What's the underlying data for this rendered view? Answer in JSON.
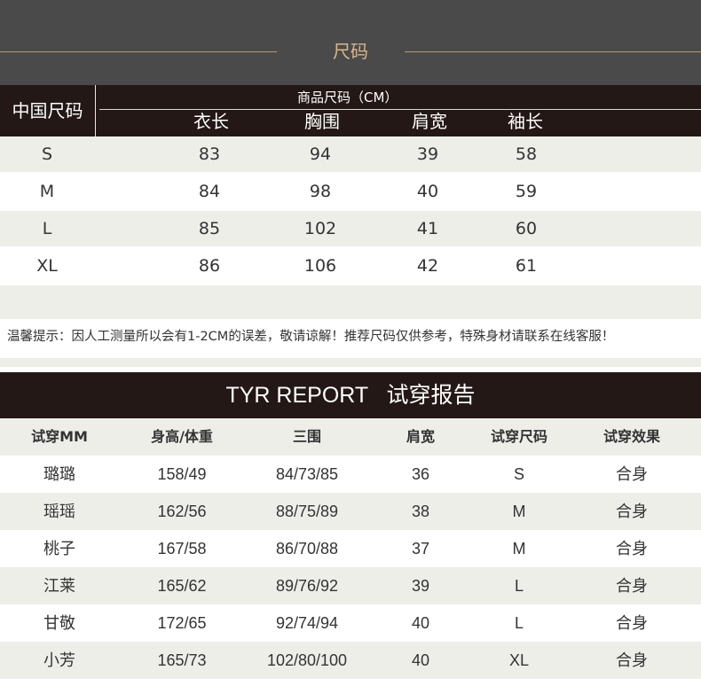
{
  "header": {
    "title": "尺码"
  },
  "size_table": {
    "cn_size_label": "中国尺码",
    "group_label": "商品尺码（CM）",
    "columns": [
      "衣长",
      "胸围",
      "肩宽",
      "袖长"
    ],
    "rows": [
      {
        "size": "S",
        "values": [
          "83",
          "94",
          "39",
          "58"
        ]
      },
      {
        "size": "M",
        "values": [
          "84",
          "98",
          "40",
          "59"
        ]
      },
      {
        "size": "L",
        "values": [
          "85",
          "102",
          "41",
          "60"
        ]
      },
      {
        "size": "XL",
        "values": [
          "86",
          "106",
          "42",
          "61"
        ]
      }
    ]
  },
  "note": "温馨提示：因人工测量所以会有1-2CM的误差，敬请谅解！推荐尺码仅供参考，特殊身材请联系在线客服！",
  "report": {
    "title": "TYR REPORT   试穿报告",
    "columns": [
      "试穿MM",
      "身高/体重",
      "三围",
      "肩宽",
      "试穿尺码",
      "试穿效果"
    ],
    "rows": [
      [
        "璐璐",
        "158/49",
        "84/73/85",
        "36",
        "S",
        "合身"
      ],
      [
        "瑶瑶",
        "162/56",
        "88/75/89",
        "38",
        "M",
        "合身"
      ],
      [
        "桃子",
        "167/58",
        "86/70/88",
        "37",
        "M",
        "合身"
      ],
      [
        "江莱",
        "165/62",
        "89/76/92",
        "39",
        "L",
        "合身"
      ],
      [
        "甘敬",
        "172/65",
        "92/74/94",
        "40",
        "L",
        "合身"
      ],
      [
        "小芳",
        "165/73",
        "102/80/100",
        "40",
        "XL",
        "合身"
      ]
    ]
  }
}
